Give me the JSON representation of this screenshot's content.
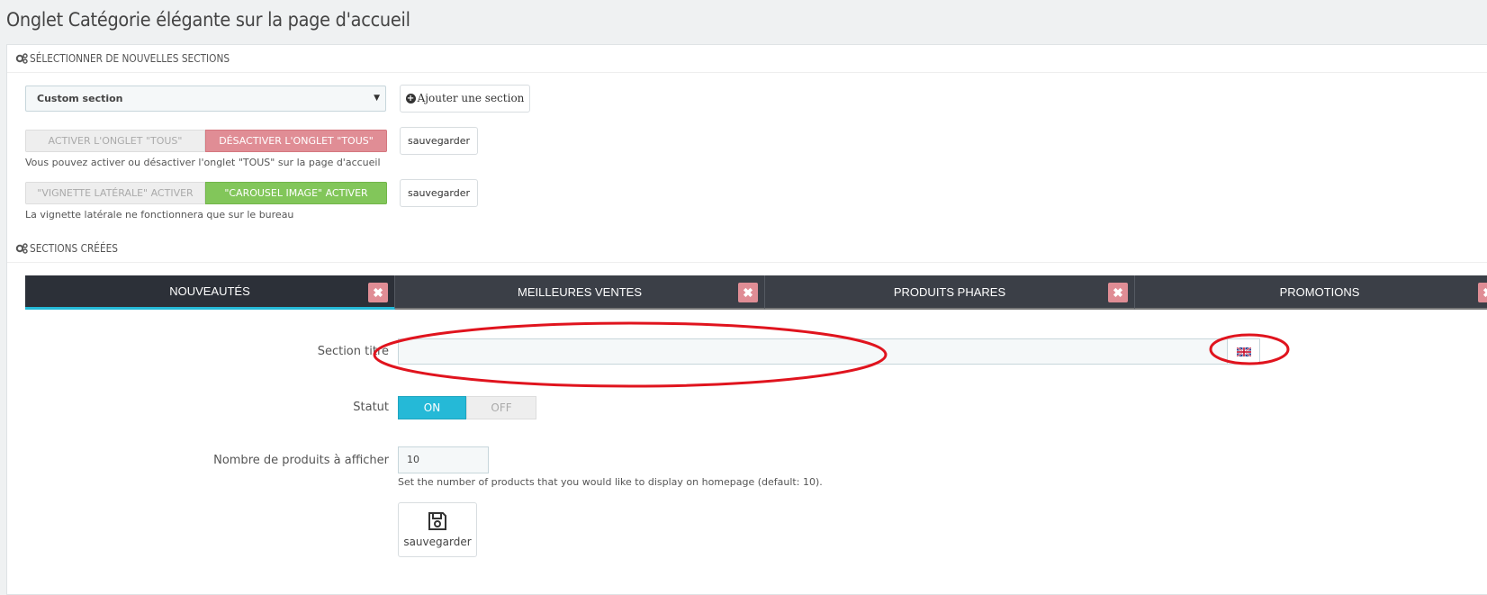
{
  "page_title": "Onglet Catégorie élégante sur la page d'accueil",
  "section_select": {
    "heading": "SÉLECTIONNER DE NOUVELLES SECTIONS",
    "selected": "Custom section",
    "add_button": "Ajouter une section"
  },
  "tab_all": {
    "activate": "ACTIVER L'ONGLET \"TOUS\"",
    "deactivate": "DÉSACTIVER L'ONGLET \"TOUS\"",
    "save": "sauvegarder",
    "help": "Vous pouvez activer ou désactiver l'onglet \"TOUS\" sur la page d'accueil"
  },
  "vignette": {
    "lateral": "\"VIGNETTE LATÉRALE\" ACTIVER",
    "carousel": "\"CAROUSEL IMAGE\" ACTIVER",
    "save": "sauvegarder",
    "help": "La vignette latérale ne fonctionnera que sur le bureau"
  },
  "created": {
    "heading": "SECTIONS CRÉÉES",
    "tabs": [
      {
        "label": "NOUVEAUTÉS"
      },
      {
        "label": "MEILLEURES VENTES"
      },
      {
        "label": "PRODUITS PHARES"
      },
      {
        "label": "PROMOTIONS"
      }
    ]
  },
  "form": {
    "title_label": "Section titre",
    "title_value": "",
    "status_label": "Statut",
    "status_on": "ON",
    "status_off": "OFF",
    "count_label": "Nombre de produits à afficher",
    "count_value": "10",
    "count_help": "Set the number of products that you would like to display on homepage (default: 10).",
    "save": "sauvegarder"
  },
  "colors": {
    "accent": "#25b9d7",
    "danger": "#e08d95",
    "success": "#82c65a",
    "annotation": "#e0141e"
  }
}
